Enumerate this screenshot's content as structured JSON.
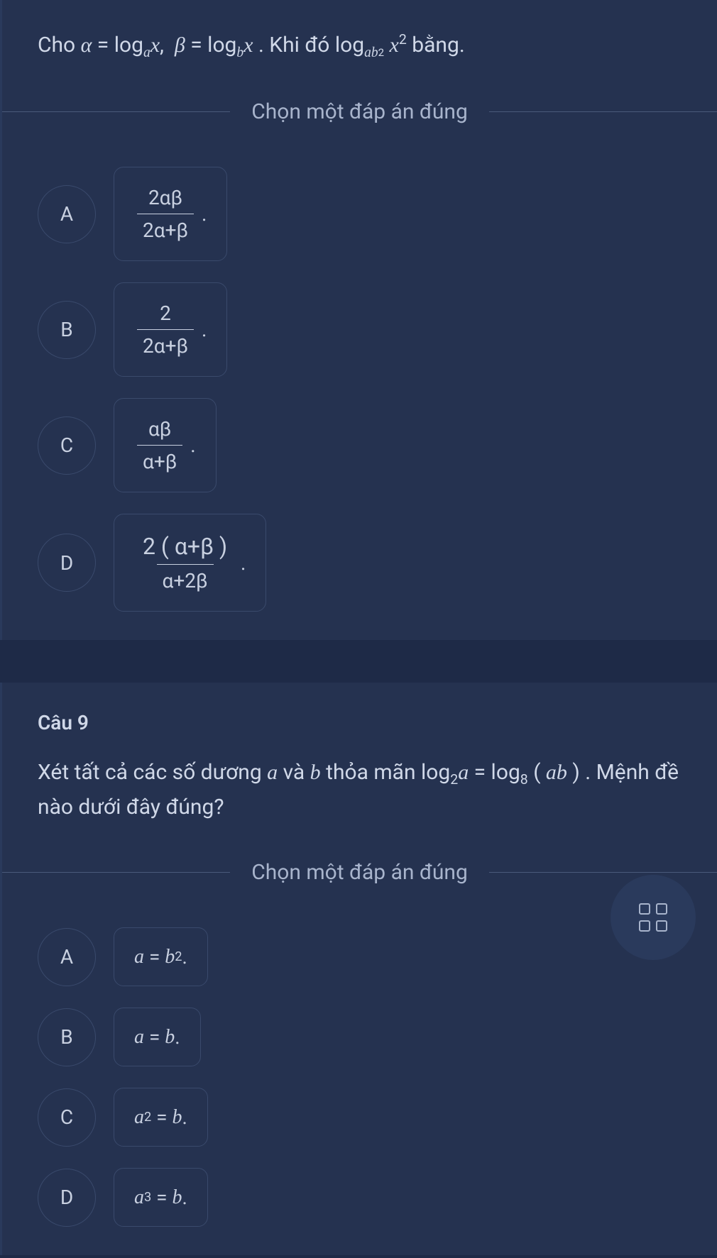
{
  "q1": {
    "text_pre": "Cho ",
    "text_mid": ". Khi đó ",
    "text_post": " bằng.",
    "divider": "Chọn một đáp án đúng",
    "A": {
      "letter": "A",
      "frac_num": "2αβ",
      "frac_den": "2α+β"
    },
    "B": {
      "letter": "B",
      "frac_num": "2",
      "frac_den": "2α+β"
    },
    "C": {
      "letter": "C",
      "frac_num": "αβ",
      "frac_den": "α+β"
    },
    "D": {
      "letter": "D",
      "frac_num": "2 ( α+β )",
      "frac_den": "α+2β"
    }
  },
  "q2": {
    "title": "Câu 9",
    "text1": "Xét tất cả các số dương ",
    "text2": " và ",
    "text3": " thỏa mãn ",
    "text4": ". Mệnh đề nào dưới đây đúng?",
    "divider": "Chọn một đáp án đúng",
    "A": {
      "letter": "A"
    },
    "B": {
      "letter": "B"
    },
    "C": {
      "letter": "C"
    },
    "D": {
      "letter": "D"
    }
  }
}
